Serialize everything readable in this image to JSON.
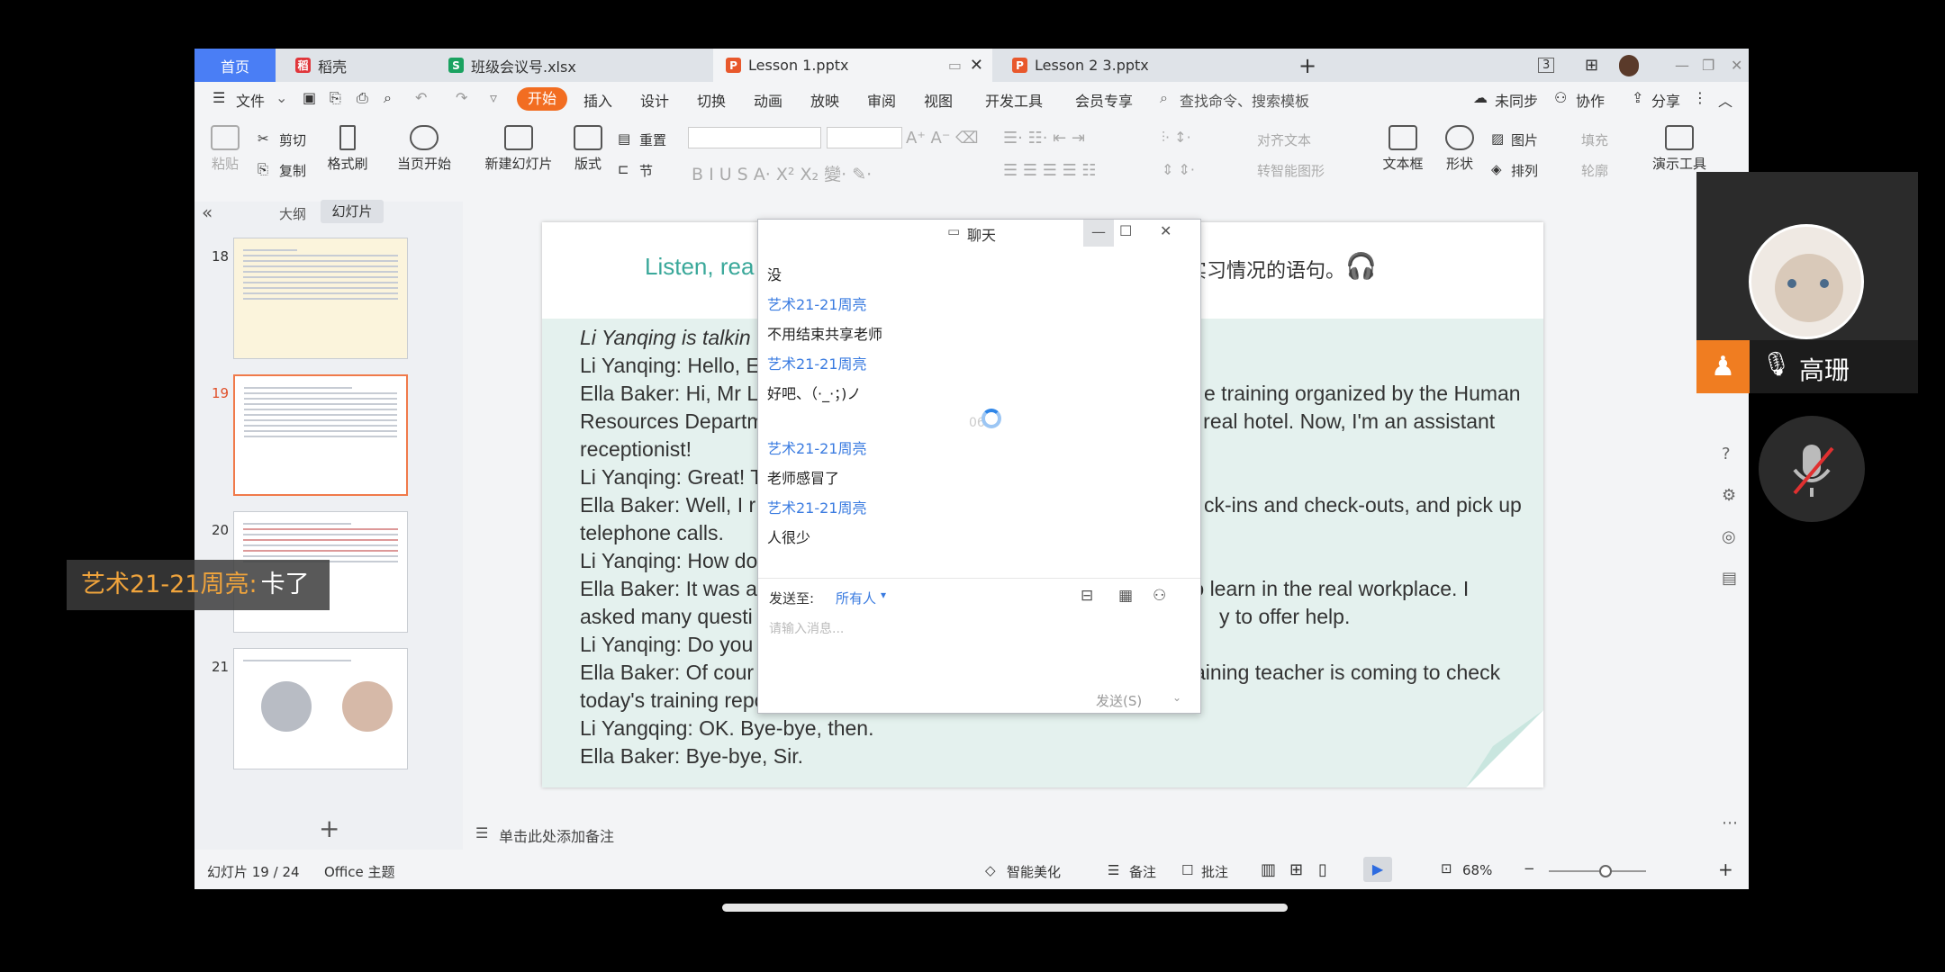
{
  "tabs": {
    "home": "首页",
    "docer": "稻壳",
    "meeting_file": "班级会议号.xlsx",
    "lesson1": "Lesson 1.pptx",
    "lesson2": "Lesson 2  3.pptx",
    "new_tab": "+",
    "page_count": "3"
  },
  "menu": {
    "file": "文件",
    "items": [
      "开始",
      "插入",
      "设计",
      "切换",
      "动画",
      "放映",
      "审阅",
      "视图",
      "开发工具",
      "会员专享"
    ],
    "search": "查找命令、搜索模板",
    "unsynced": "未同步",
    "collab": "协作",
    "share": "分享"
  },
  "ribbon": {
    "paste": "粘贴",
    "cut": "剪切",
    "copy": "复制",
    "format_painter": "格式刷",
    "from_current": "当页开始",
    "new_slide": "新建幻灯片",
    "layout": "版式",
    "section": "节",
    "reset": "重置",
    "align_text": "对齐文本",
    "smartart": "转智能图形",
    "textbox": "文本框",
    "shape": "形状",
    "image": "图片",
    "arrange": "排列",
    "fill": "填充",
    "outline": "轮廓",
    "presentation_tools": "演示工具"
  },
  "panel": {
    "outline_tab": "大纲",
    "slides_tab": "幻灯片",
    "slides": [
      {
        "num": "18"
      },
      {
        "num": "19"
      },
      {
        "num": "20"
      },
      {
        "num": "21"
      }
    ],
    "add": "+"
  },
  "slide": {
    "title": "Listen, rea",
    "title_suffix": "实习情况的语句。",
    "lines": [
      "Li Yanqing is talkin",
      "Li Yanqing: Hello, E",
      "Ella Baker: Hi, Mr L",
      "Resources Departm",
      "receptionist!",
      "Li Yanqing: Great! T",
      "Ella Baker: Well, I r",
      "telephone calls.",
      "Li Yanqing: How do",
      "Ella Baker: It was a",
      "asked many questi",
      "Li Yanqing: Do you",
      "Ella Baker: Of cour",
      "today's training report. I have to hang up now.",
      "Li Yangqing: OK. Bye-bye, then.",
      "Ella Baker: Bye-bye, Sir."
    ],
    "right_lines": [
      "e training organized by the Human",
      "a real hotel. Now, I'm an assistant",
      "ck-ins and check-outs, and pick up",
      "to learn in the real workplace. I",
      "y to offer help.",
      "aining teacher is coming to check"
    ],
    "notes": "单击此处添加备注"
  },
  "chat": {
    "title": "聊天",
    "messages": [
      {
        "text": "没"
      },
      {
        "name": "艺术21-21周亮",
        "text": "不用结束共享老师"
      },
      {
        "name": "艺术21-21周亮",
        "text": "好吧、（·_·；)ノ"
      },
      {
        "name": "艺术21-21周亮",
        "text": "老师感冒了"
      },
      {
        "name": "艺术21-21周亮",
        "text": "人很少"
      }
    ],
    "send_to_label": "发送至:",
    "send_to_value": "所有人",
    "placeholder": "请输入消息...",
    "send": "发送(S)",
    "loading": "06"
  },
  "status": {
    "slide_pos": "幻灯片 19 / 24",
    "theme": "Office 主题",
    "beautify": "智能美化",
    "notes": "备注",
    "comment": "批注",
    "zoom": "68%"
  },
  "video": {
    "name": "高珊"
  },
  "danmu": {
    "sender": "艺术21-21周亮:",
    "text": "卡了"
  }
}
